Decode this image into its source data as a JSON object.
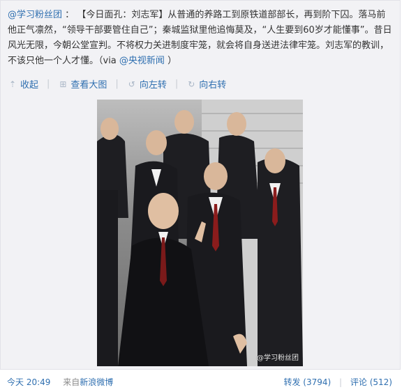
{
  "post": {
    "mention": "@学习粉丝团",
    "colon": "：",
    "body": "【今日面孔：刘志军】从普通的养路工到原铁道部部长，再到阶下囚。落马前他正气凛然，“领导干部要管住自己”；秦城监狱里他追悔莫及，“人生要到60岁才能懂事”。昔日风光无限，今朝公堂宣判。不将权力关进制度牢笼，就会将自身送进法律牢笼。刘志军的教训，不该只他一个人才懂。（via",
    "via_link": "@央视新闻",
    "close": "）"
  },
  "actions": {
    "collapse": "收起",
    "view_large": "查看大图",
    "rotate_left": "向左转",
    "rotate_right": "向右转"
  },
  "photo": {
    "watermark": "@学习粉丝团"
  },
  "footer": {
    "time": "今天 20:49",
    "source_prefix": "来自",
    "source_link": "新浪微博",
    "repost": "转发 (3794)",
    "comment": "评论 (512)"
  },
  "colors": {
    "link": "#2f6fb0",
    "repost_bg": "#f2f2f5"
  }
}
